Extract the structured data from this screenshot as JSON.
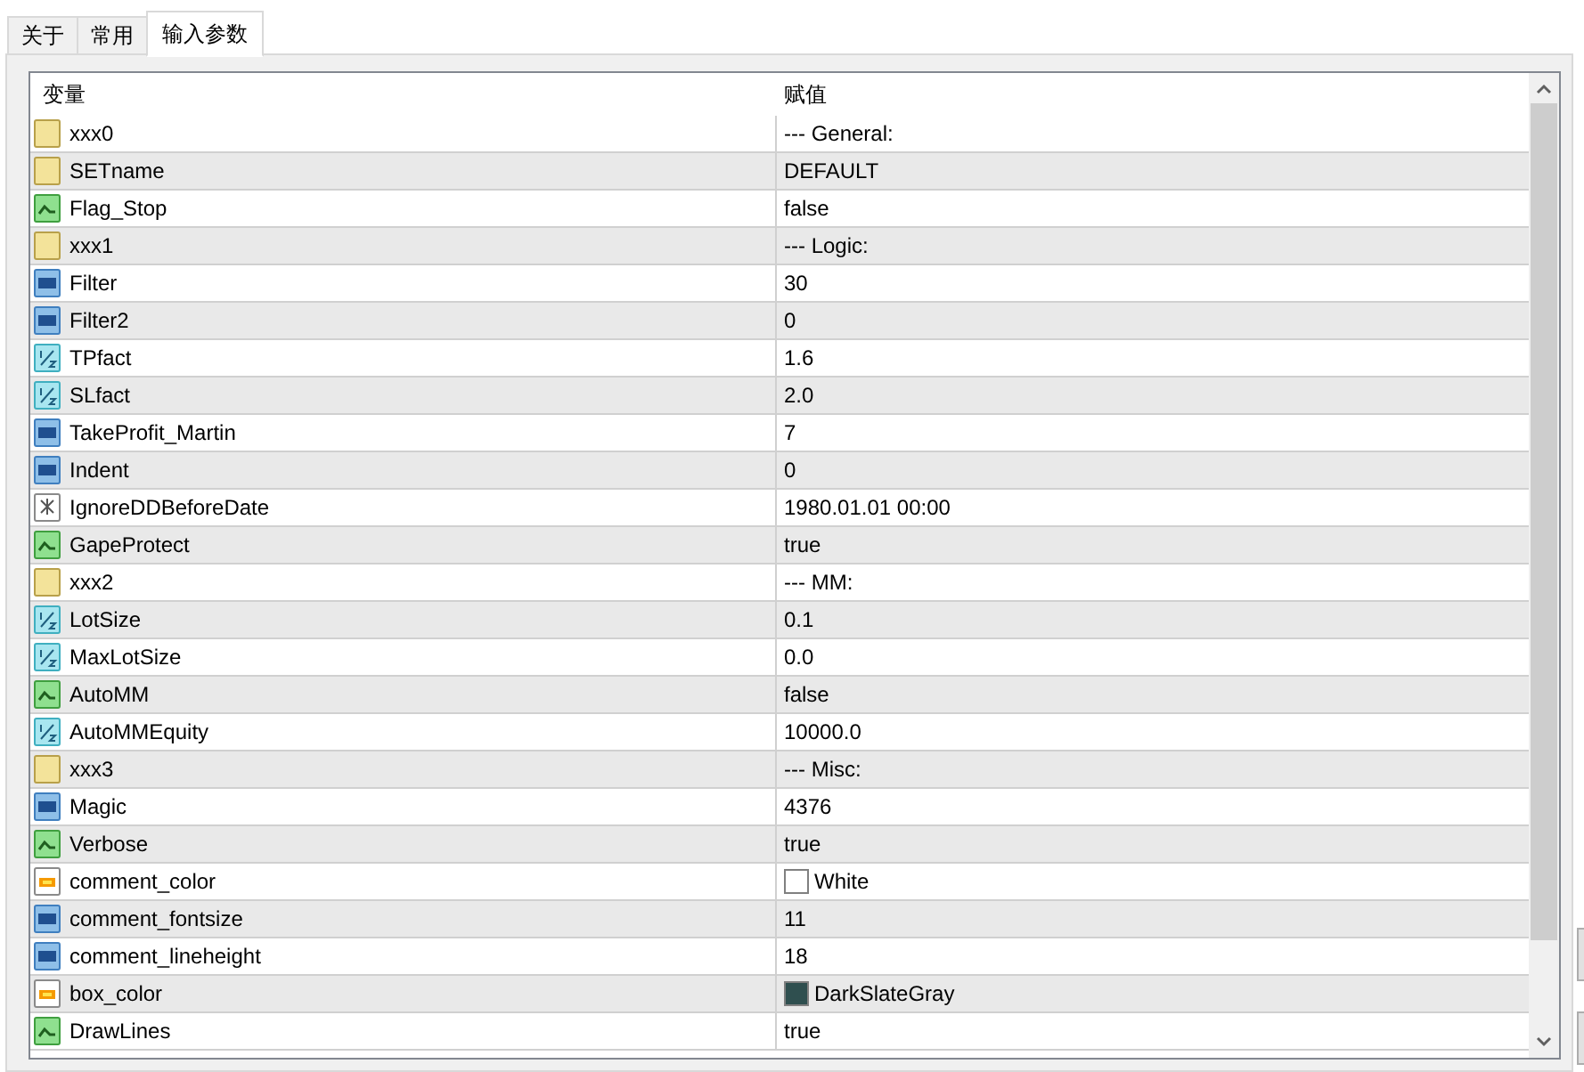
{
  "tabs": [
    {
      "label": "关于",
      "selected": false
    },
    {
      "label": "常用",
      "selected": false
    },
    {
      "label": "输入参数",
      "selected": true
    }
  ],
  "table": {
    "columns": [
      "变量",
      "赋值"
    ],
    "rows": [
      {
        "kind": "string",
        "name": "xxx0",
        "value": "--- General:"
      },
      {
        "kind": "string",
        "name": "SETname",
        "value": "DEFAULT"
      },
      {
        "kind": "bool",
        "name": "Flag_Stop",
        "value": "false"
      },
      {
        "kind": "string",
        "name": "xxx1",
        "value": "--- Logic:"
      },
      {
        "kind": "int",
        "name": "Filter",
        "value": "30"
      },
      {
        "kind": "int",
        "name": "Filter2",
        "value": "0"
      },
      {
        "kind": "double",
        "name": "TPfact",
        "value": "1.6"
      },
      {
        "kind": "double",
        "name": "SLfact",
        "value": "2.0"
      },
      {
        "kind": "int",
        "name": "TakeProfit_Martin",
        "value": "7"
      },
      {
        "kind": "int",
        "name": "Indent",
        "value": "0"
      },
      {
        "kind": "datetime",
        "name": "IgnoreDDBeforeDate",
        "value": "1980.01.01 00:00"
      },
      {
        "kind": "bool",
        "name": "GapeProtect",
        "value": "true"
      },
      {
        "kind": "string",
        "name": "xxx2",
        "value": "--- MM:"
      },
      {
        "kind": "double",
        "name": "LotSize",
        "value": "0.1"
      },
      {
        "kind": "double",
        "name": "MaxLotSize",
        "value": "0.0"
      },
      {
        "kind": "bool",
        "name": "AutoMM",
        "value": "false"
      },
      {
        "kind": "double",
        "name": "AutoMMEquity",
        "value": "10000.0"
      },
      {
        "kind": "string",
        "name": "xxx3",
        "value": "--- Misc:"
      },
      {
        "kind": "int",
        "name": "Magic",
        "value": "4376"
      },
      {
        "kind": "bool",
        "name": "Verbose",
        "value": "true"
      },
      {
        "kind": "color",
        "name": "comment_color",
        "value": "White",
        "color": "#ffffff"
      },
      {
        "kind": "int",
        "name": "comment_fontsize",
        "value": "11"
      },
      {
        "kind": "int",
        "name": "comment_lineheight",
        "value": "18"
      },
      {
        "kind": "color",
        "name": "box_color",
        "value": "DarkSlateGray",
        "color": "#2f4f4f"
      },
      {
        "kind": "bool",
        "name": "DrawLines",
        "value": "true"
      }
    ]
  }
}
